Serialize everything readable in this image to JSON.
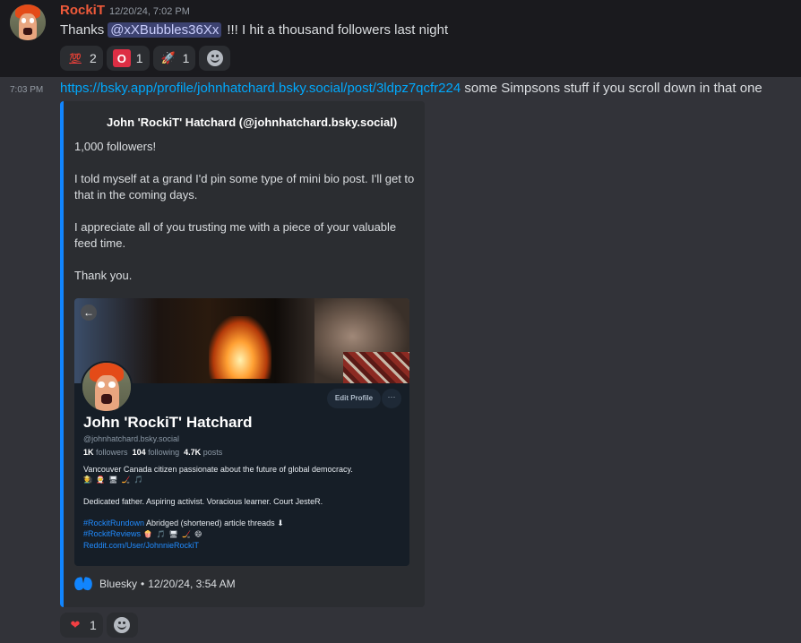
{
  "message1": {
    "author": "RockiT",
    "timestamp": "12/20/24, 7:02 PM",
    "text_before": "Thanks",
    "mention": "@xXBubbles36Xx",
    "text_after": "!!! I hit a thousand followers last night",
    "reactions": [
      {
        "emoji": "💯",
        "count": "2"
      },
      {
        "emoji": "O",
        "count": "1"
      },
      {
        "emoji": "🚀",
        "count": "1"
      }
    ]
  },
  "message2": {
    "timestamp": "7:03 PM",
    "link": "https://bsky.app/profile/johnhatchard.bsky.social/post/3ldpz7qcfr224",
    "text": " some Simpsons stuff if you scroll down in that one",
    "reactions": [
      {
        "emoji": "❤",
        "count": "1"
      }
    ]
  },
  "embed": {
    "title": "John 'RockiT' Hatchard (@johnhatchard.bsky.social)",
    "paragraphs": [
      "1,000 followers!",
      "I told myself at a grand I'd pin some type of mini bio post. I'll get to that in the coming days.",
      "I appreciate all of you trusting me with a piece of your valuable feed time.",
      "Thank you."
    ],
    "footer_source": "Bluesky",
    "footer_sep": "•",
    "footer_time": "12/20/24, 3:54 AM"
  },
  "profile_card": {
    "edit_button": "Edit Profile",
    "more_button": "···",
    "back_icon": "←",
    "name": "John 'RockiT' Hatchard",
    "handle": "@johnhatchard.bsky.social",
    "followers_count": "1K",
    "followers_label": "followers",
    "following_count": "104",
    "following_label": "following",
    "posts_count": "4.7K",
    "posts_label": "posts",
    "bio_line1": "Vancouver Canada citizen passionate about the future of global democracy.",
    "bio_line1_emoji": "🧑‍🌾 🧑‍🎄 🖥 🏒 🎵",
    "bio_line2": "Dedicated father. Aspiring activist. Voracious learner. Court JesteR.",
    "hashtag1": "#RockitRundown",
    "hashtag1_text": " Abridged (shortened) article threads ⬇",
    "hashtag2": "#RockitReviews",
    "hashtag2_emoji": " 🍿 🎵 🖥 🏒 😄",
    "reddit_link": "Reddit.com/User/JohnnieRockiT"
  },
  "colors": {
    "author": "#f05a3a",
    "link": "#00a8fc",
    "embed_border": "#1185fe",
    "bluesky_blue": "#1185fe"
  }
}
